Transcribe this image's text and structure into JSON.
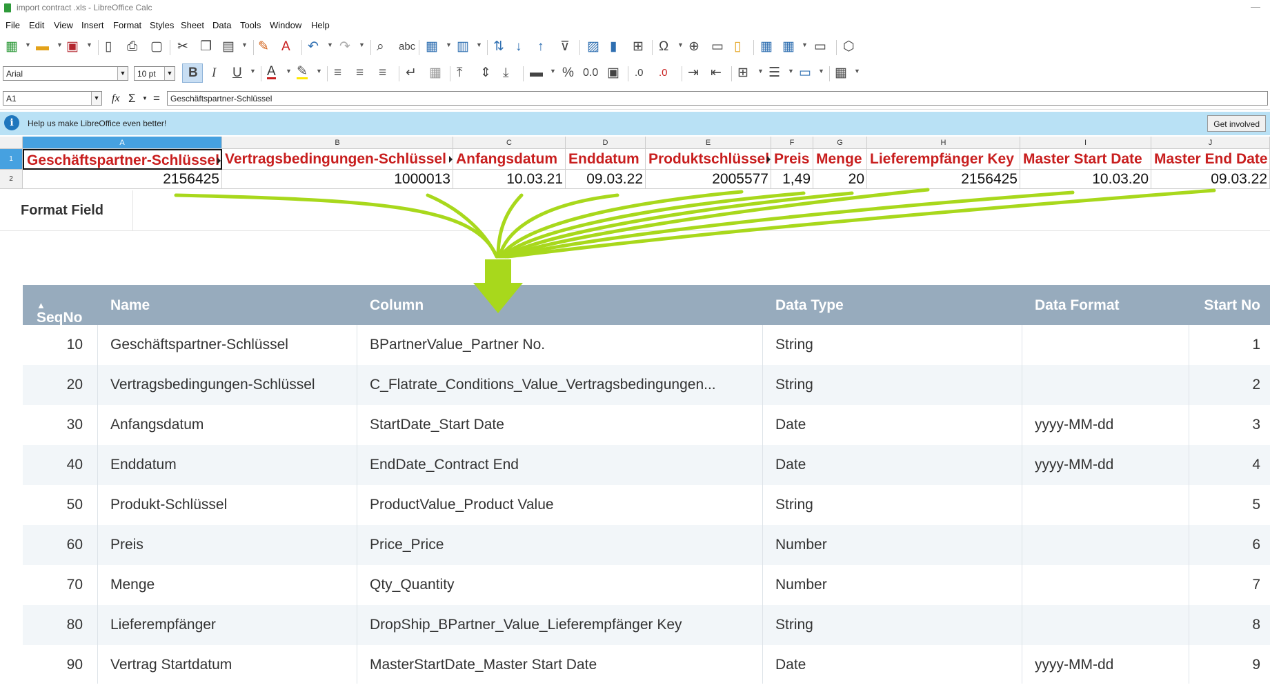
{
  "window": {
    "title": "import contract .xls - LibreOffice Calc",
    "minimize": "—"
  },
  "menu": [
    "File",
    "Edit",
    "View",
    "Insert",
    "Format",
    "Styles",
    "Sheet",
    "Data",
    "Tools",
    "Window",
    "Help"
  ],
  "format_toolbar": {
    "font_name": "Arial",
    "font_size": "10 pt"
  },
  "formula_bar": {
    "name_box": "A1",
    "content": "Geschäftspartner-Schlüssel",
    "fx": "fx",
    "sigma": "Σ",
    "equals": "="
  },
  "infobar": {
    "text": "Help us make LibreOffice even better!",
    "button": "Get involved",
    "icon": "i"
  },
  "sheet": {
    "columns": [
      "A",
      "B",
      "C",
      "D",
      "E",
      "F",
      "G",
      "H",
      "I",
      "J"
    ],
    "rows": [
      "1",
      "2"
    ],
    "row1": [
      "Geschäftspartner-Schlüssel",
      "Vertragsbedingungen-Schlüssel",
      "Anfangsdatum",
      "Enddatum",
      "Produktschlüssel",
      "Preis",
      "Menge",
      "Lieferempfänger Key",
      "Master Start Date",
      "Master End Date"
    ],
    "row2": [
      "2156425",
      "1000013",
      "10.03.21",
      "09.03.22",
      "2005577",
      "1,49",
      "20",
      "2156425",
      "10.03.20",
      "09.03.22"
    ]
  },
  "tab": {
    "label": "Format Field"
  },
  "grid": {
    "headers": {
      "seqno": "SeqNo",
      "sort_icon": "▲",
      "name": "Name",
      "column": "Column",
      "data_type": "Data Type",
      "data_format": "Data Format",
      "start_no": "Start No"
    },
    "rows": [
      {
        "seqno": "10",
        "name": "Geschäftspartner-Schlüssel",
        "column": "BPartnerValue_Partner No.",
        "type": "String",
        "format": "",
        "start": "1"
      },
      {
        "seqno": "20",
        "name": "Vertragsbedingungen-Schlüssel",
        "column": "C_Flatrate_Conditions_Value_Vertragsbedingungen...",
        "type": "String",
        "format": "",
        "start": "2"
      },
      {
        "seqno": "30",
        "name": "Anfangsdatum",
        "column": "StartDate_Start Date",
        "type": "Date",
        "format": "yyyy-MM-dd",
        "start": "3"
      },
      {
        "seqno": "40",
        "name": "Enddatum",
        "column": "EndDate_Contract End",
        "type": "Date",
        "format": "yyyy-MM-dd",
        "start": "4"
      },
      {
        "seqno": "50",
        "name": "Produkt-Schlüssel",
        "column": "ProductValue_Product Value",
        "type": "String",
        "format": "",
        "start": "5"
      },
      {
        "seqno": "60",
        "name": "Preis",
        "column": "Price_Price",
        "type": "Number",
        "format": "",
        "start": "6"
      },
      {
        "seqno": "70",
        "name": "Menge",
        "column": "Qty_Quantity",
        "type": "Number",
        "format": "",
        "start": "7"
      },
      {
        "seqno": "80",
        "name": "Lieferempfänger",
        "column": "DropShip_BPartner_Value_Lieferempfänger Key",
        "type": "String",
        "format": "",
        "start": "8"
      },
      {
        "seqno": "90",
        "name": "Vertrag Startdatum",
        "column": "MasterStartDate_Master Start Date",
        "type": "Date",
        "format": "yyyy-MM-dd",
        "start": "9"
      }
    ]
  },
  "colors": {
    "accent_green": "#a8d81c",
    "header_red": "#c81e1e",
    "grid_header": "#97abbd",
    "selection_blue": "#46a1e0",
    "infobar": "#b9e1f5"
  }
}
